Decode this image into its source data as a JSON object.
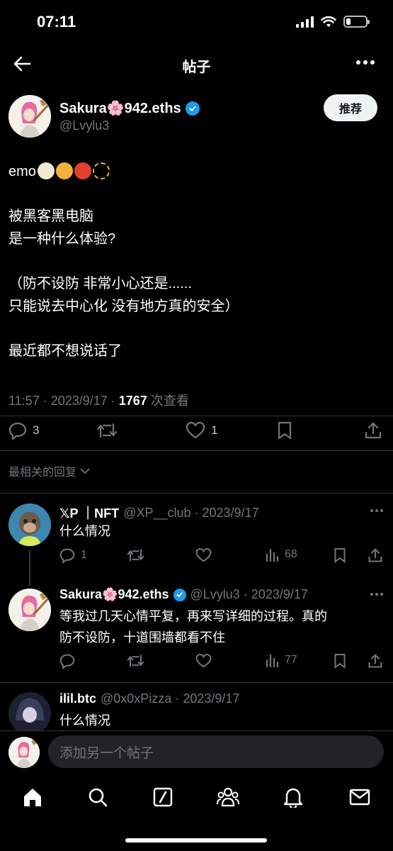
{
  "status": {
    "time": "07:11"
  },
  "header": {
    "title": "帖子"
  },
  "post": {
    "author_name": "Sakura🌸942.eths",
    "author_handle": "@Lvylu3",
    "follow_label": "推荐",
    "line1": "emo",
    "para1": "被黑客黑电脑\n是一种什么体验?",
    "para2": "（防不设防 非常小心还是......\n只能说去中心化 没有地方真的安全）",
    "para3": "最近都不想说话了",
    "time": "11:57 · 2023/9/17 · ",
    "views": "1767",
    "views_label": " 次查看",
    "replies": "3",
    "likes": "1"
  },
  "filter_label": "最相关的回复",
  "replies": [
    {
      "name": "𝕏P ｜NFT",
      "handle": "@XP__club · 2023/9/17",
      "text": "什么情况",
      "replies": "1",
      "views": "68"
    },
    {
      "name": "Sakura🌸942.eths",
      "handle": "@Lvylu3 · 2023/9/17",
      "text": "等我过几天心情平复，再来写详细的过程。真的\n防不设防，十道围墙都看不住",
      "views": "77"
    },
    {
      "name": "ilil.btc",
      "handle": "@0x0xPizza · 2023/9/17",
      "text": "什么情况"
    }
  ],
  "compose": {
    "placeholder": "添加另一个帖子"
  },
  "colors": {
    "accent": "#1d9bf0",
    "background": "#000000",
    "muted": "#71767b"
  }
}
